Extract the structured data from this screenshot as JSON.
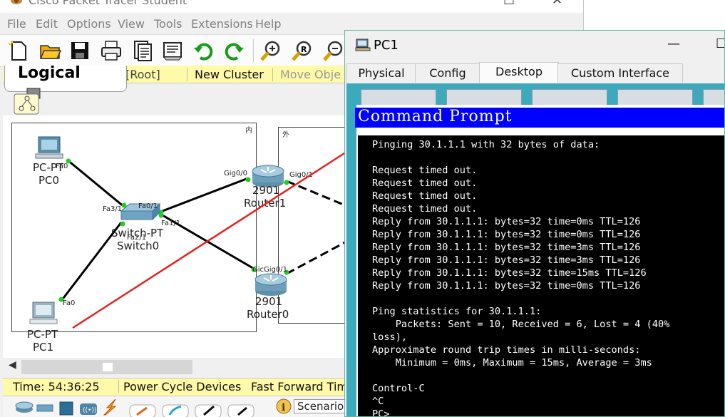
{
  "app": {
    "title": "Cisco Packet Tracer Student",
    "menu": [
      "File",
      "Edit",
      "Options",
      "View",
      "Tools",
      "Extensions",
      "Help"
    ]
  },
  "workspace": {
    "mode_label": "Logical",
    "root_label": "[Root]",
    "new_cluster_label": "New Cluster",
    "move_object_label": "Move Obje"
  },
  "topology": {
    "cluster_inner_tag": "内",
    "cluster_outer_tag": "外",
    "devices": {
      "pc0": {
        "type": "PC-PT",
        "name": "PC0"
      },
      "pc1": {
        "type": "PC-PT",
        "name": "PC1"
      },
      "switch0": {
        "type": "Switch-PT",
        "name": "Switch0"
      },
      "router1": {
        "type": "2901",
        "name": "Router1"
      },
      "router0": {
        "type": "2901",
        "name": "Router0"
      }
    },
    "ports": {
      "pc0_fa0": "Fa0",
      "pc1_fa0": "Fa0",
      "sw_fa01": "Fa0/1",
      "sw_fa11": "Fa1/1",
      "sw_fa21": "Fa2/1",
      "sw_fa31": "Fa3/1",
      "r1_gig00": "Gig0/0",
      "r1_gig01": "Gig0/1",
      "r0_gig": "Gic",
      "r0_gig01": "Gig0/1"
    }
  },
  "status": {
    "time": "Time: 54:36:25",
    "power_cycle": "Power Cycle Devices",
    "fast_forward": "Fast Forward Tim"
  },
  "scenario": {
    "label": "Scenario"
  },
  "pc_window": {
    "title": "PC1",
    "tabs": [
      "Physical",
      "Config",
      "Desktop",
      "Custom Interface"
    ],
    "active_tab": "Desktop",
    "command_prompt_title": "Command Prompt",
    "console_lines": [
      "Pinging 30.1.1.1 with 32 bytes of data:",
      "",
      "Request timed out.",
      "Request timed out.",
      "Request timed out.",
      "Request timed out.",
      "Reply from 30.1.1.1: bytes=32 time=0ms TTL=126",
      "Reply from 30.1.1.1: bytes=32 time=0ms TTL=126",
      "Reply from 30.1.1.1: bytes=32 time=3ms TTL=126",
      "Reply from 30.1.1.1: bytes=32 time=3ms TTL=126",
      "Reply from 30.1.1.1: bytes=32 time=15ms TTL=126",
      "Reply from 30.1.1.1: bytes=32 time=0ms TTL=126",
      "",
      "Ping statistics for 30.1.1.1:",
      "    Packets: Sent = 10, Received = 6, Lost = 4 (40%",
      "loss),",
      "Approximate round trip times in milli-seconds:",
      "    Minimum = 0ms, Maximum = 15ms, Average = 3ms",
      "",
      "Control-C",
      "^C",
      "PC>"
    ]
  },
  "colors": {
    "workspace_bar": "#fffaa8",
    "desktop_bg": "#3da9bd",
    "cmd_title_bg": "#0000ff",
    "link_dot": "#22cc22",
    "annotation_arrow": "#e8201c"
  }
}
